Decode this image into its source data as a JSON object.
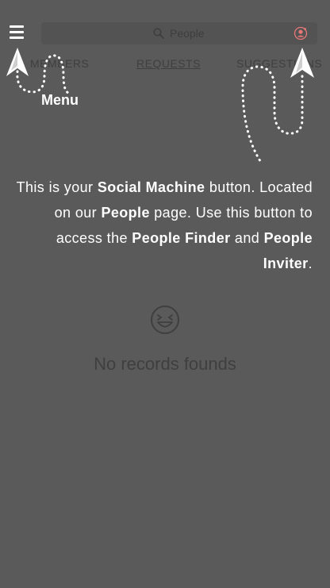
{
  "search": {
    "placeholder": "People"
  },
  "tabs": [
    {
      "label": "MEMBERS"
    },
    {
      "label": "REQUESTS",
      "active": true
    },
    {
      "label": "SUGGESTIONS"
    }
  ],
  "empty_state": {
    "message": "No records founds"
  },
  "coachmark": {
    "menu_label": "Menu",
    "hint": {
      "t1": "This is your ",
      "b1": "Social Machine",
      "t2": " button. Located on our ",
      "b2": "People",
      "t3": " page. Use this button to access the ",
      "b3": "People Finder",
      "t4": " and ",
      "b4": "People Inviter",
      "t5": "."
    }
  },
  "icons": {
    "menu": "hamburger-icon",
    "search": "search-icon",
    "social_machine": "social-machine-icon",
    "empty": "laughing-face-icon"
  },
  "colors": {
    "overlay": "#5a5a5a",
    "accent": "#e87878",
    "text": "#ffffff"
  }
}
